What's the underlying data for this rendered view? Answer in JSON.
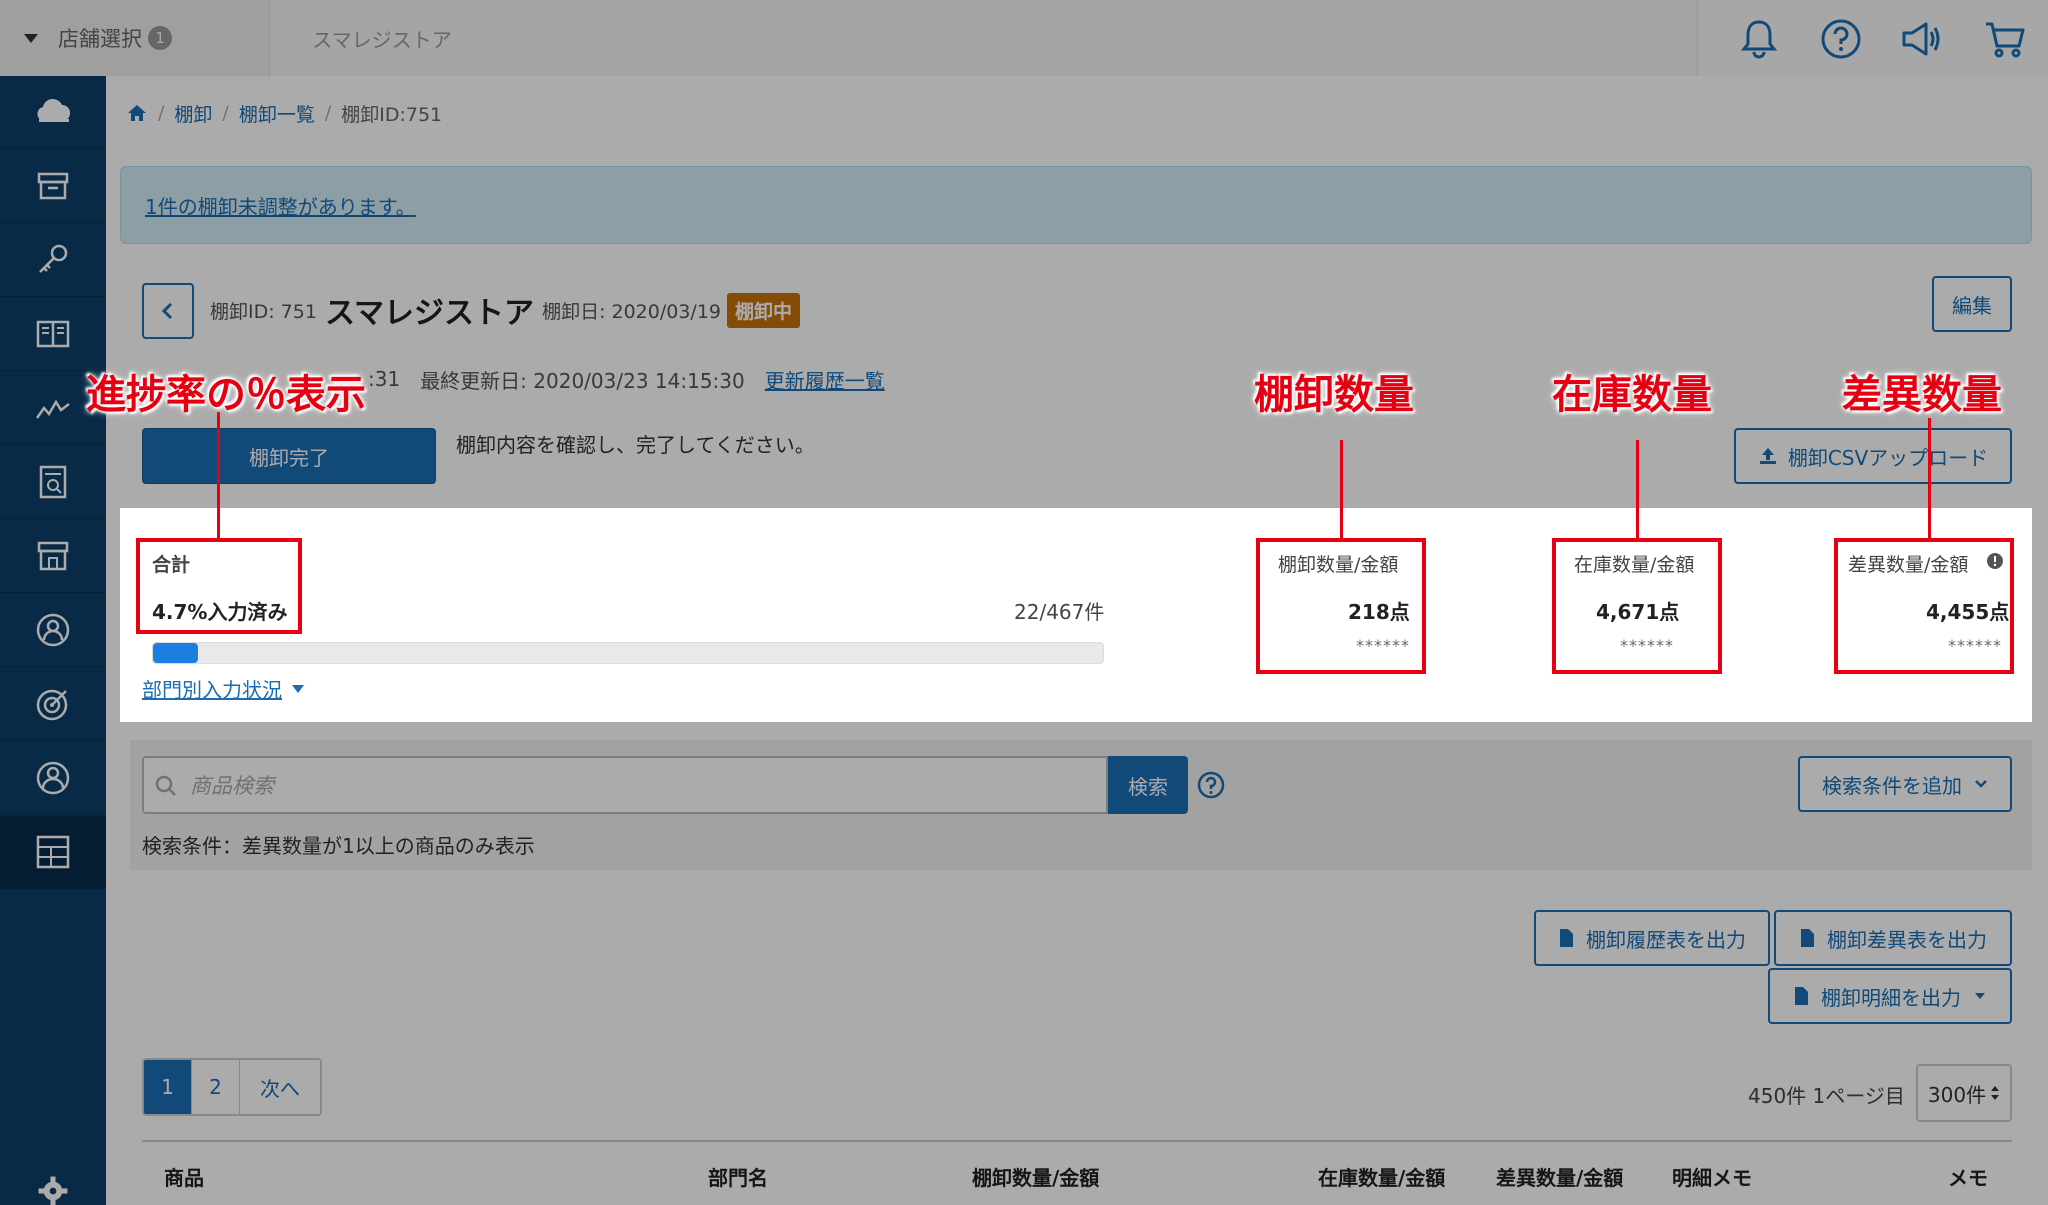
{
  "topbar": {
    "store_select_label": "店舗選択",
    "store_select_count": "1",
    "current_store": "スマレジストア",
    "icons": [
      "bell-icon",
      "help-icon",
      "megaphone-icon",
      "cart-icon"
    ]
  },
  "sidebar": {
    "icons": [
      "cloud-icon",
      "archive-icon",
      "key-icon",
      "book-icon",
      "chart-icon",
      "report-icon",
      "store-icon",
      "user-icon",
      "target-icon",
      "account-icon",
      "inventory-icon",
      "gear-icon"
    ],
    "active_index": 10
  },
  "breadcrumb": {
    "home_icon": "home-icon",
    "items": [
      "棚卸",
      "棚卸一覧",
      "棚卸ID:751"
    ]
  },
  "alert": {
    "link_text": "1件の棚卸未調整があります。"
  },
  "header": {
    "id_label": "棚卸ID: 751",
    "store_name": "スマレジストア",
    "date_label": "棚卸日: 2020/03/19",
    "status": "棚卸中",
    "edit_label": "編集"
  },
  "meta": {
    "created_partial": ":31",
    "updated": "最終更新日: 2020/03/23 14:15:30",
    "history_link": "更新履歴一覧"
  },
  "actions": {
    "complete_label": "棚卸完了",
    "confirm_text": "棚卸内容を確認し、完了してください。",
    "csv_upload_label": "棚卸CSVアップロード"
  },
  "summary": {
    "total_label": "合計",
    "progress_text": "4.7%入力済み",
    "progress_fraction": 0.047,
    "count_text": "22/467件",
    "dept_link": "部門別入力状況",
    "stocktake": {
      "label": "棚卸数量/金額",
      "value": "218点",
      "amount": "******"
    },
    "inventory": {
      "label": "在庫数量/金額",
      "value": "4,671点",
      "amount": "******"
    },
    "difference": {
      "label": "差異数量/金額",
      "value": "4,455点",
      "amount": "******"
    }
  },
  "annotations": {
    "progress": "進捗率の％表示",
    "stocktake": "棚卸数量",
    "inventory": "在庫数量",
    "difference": "差異数量"
  },
  "search": {
    "placeholder": "商品検索",
    "button": "検索",
    "add_condition": "検索条件を追加",
    "condition_text": "検索条件：差異数量が1以上の商品のみ表示"
  },
  "exports": {
    "history": "棚卸履歴表を出力",
    "difference": "棚卸差異表を出力",
    "detail": "棚卸明細を出力"
  },
  "pagination": {
    "pages": [
      "1",
      "2"
    ],
    "next": "次へ",
    "info": "450件 1ページ目",
    "per_page": "300件"
  },
  "table": {
    "headers": [
      "商品",
      "部門名",
      "棚卸数量/金額",
      "在庫数量/金額",
      "差異数量/金額",
      "明細メモ",
      "メモ"
    ]
  },
  "colors": {
    "primary": "#1a6db3",
    "sidebar": "#0d3f6b",
    "status": "#c7720a",
    "annotation": "#e60012"
  }
}
